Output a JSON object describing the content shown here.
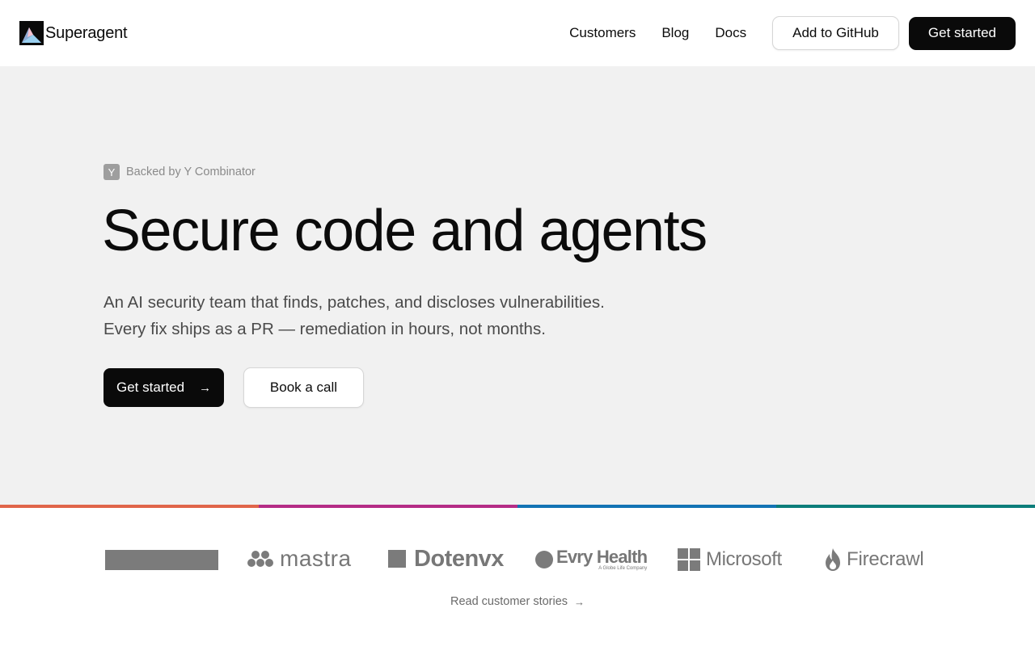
{
  "header": {
    "brand_name": "Superagent",
    "nav": [
      "Customers",
      "Blog",
      "Docs"
    ],
    "github_button": "Add to GitHub",
    "get_started_button": "Get started"
  },
  "hero": {
    "yc_badge_letter": "Y",
    "yc_text": "Backed by Y Combinator",
    "title": "Secure code and agents",
    "subtitle_line1": "An AI security team that finds, patches, and discloses vulnerabilities.",
    "subtitle_line2": "Every fix ships as a PR — remediation in hours, not months.",
    "cta_primary": "Get started",
    "cta_secondary": "Book a call"
  },
  "strip_colors": [
    "#e0654a",
    "#b52c86",
    "#1373b4",
    "#0c7d7a"
  ],
  "logos": {
    "mastra": "mastra",
    "dotenvx": "Dotenvx",
    "evry": "Evry Health",
    "evry_tagline": "A Globe Life Company",
    "microsoft": "Microsoft",
    "firecrawl": "Firecrawl"
  },
  "stories_link": "Read customer stories",
  "colors": {
    "accent": "#0a0a0a",
    "hero_bg": "#f1f1f1",
    "muted": "#777777"
  }
}
